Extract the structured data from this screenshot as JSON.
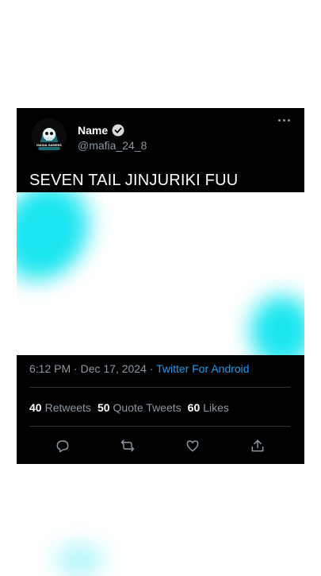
{
  "tweet": {
    "name": "Name",
    "handle": "@mafia_24_8",
    "text": "SEVEN TAIL JINJURIKI FUU",
    "avatar_caption": "MAGIA GAMERS",
    "time": "6:12 PM",
    "date": "Dec 17, 2024",
    "source": "Twitter For Android",
    "separator": "·",
    "stats": {
      "retweets_count": "40",
      "retweets_label": "Retweets",
      "quotes_count": "50",
      "quotes_label": "Quote Tweets",
      "likes_count": "60",
      "likes_label": "Likes"
    }
  },
  "icons": [
    "verified-badge-icon",
    "more-options-icon",
    "reply-icon",
    "retweet-icon",
    "like-icon",
    "share-icon"
  ],
  "colors": {
    "card": "#000000",
    "muted": "#8b98a5",
    "link": "#1d9bf0",
    "accent_cyan": "#19e6f0"
  }
}
